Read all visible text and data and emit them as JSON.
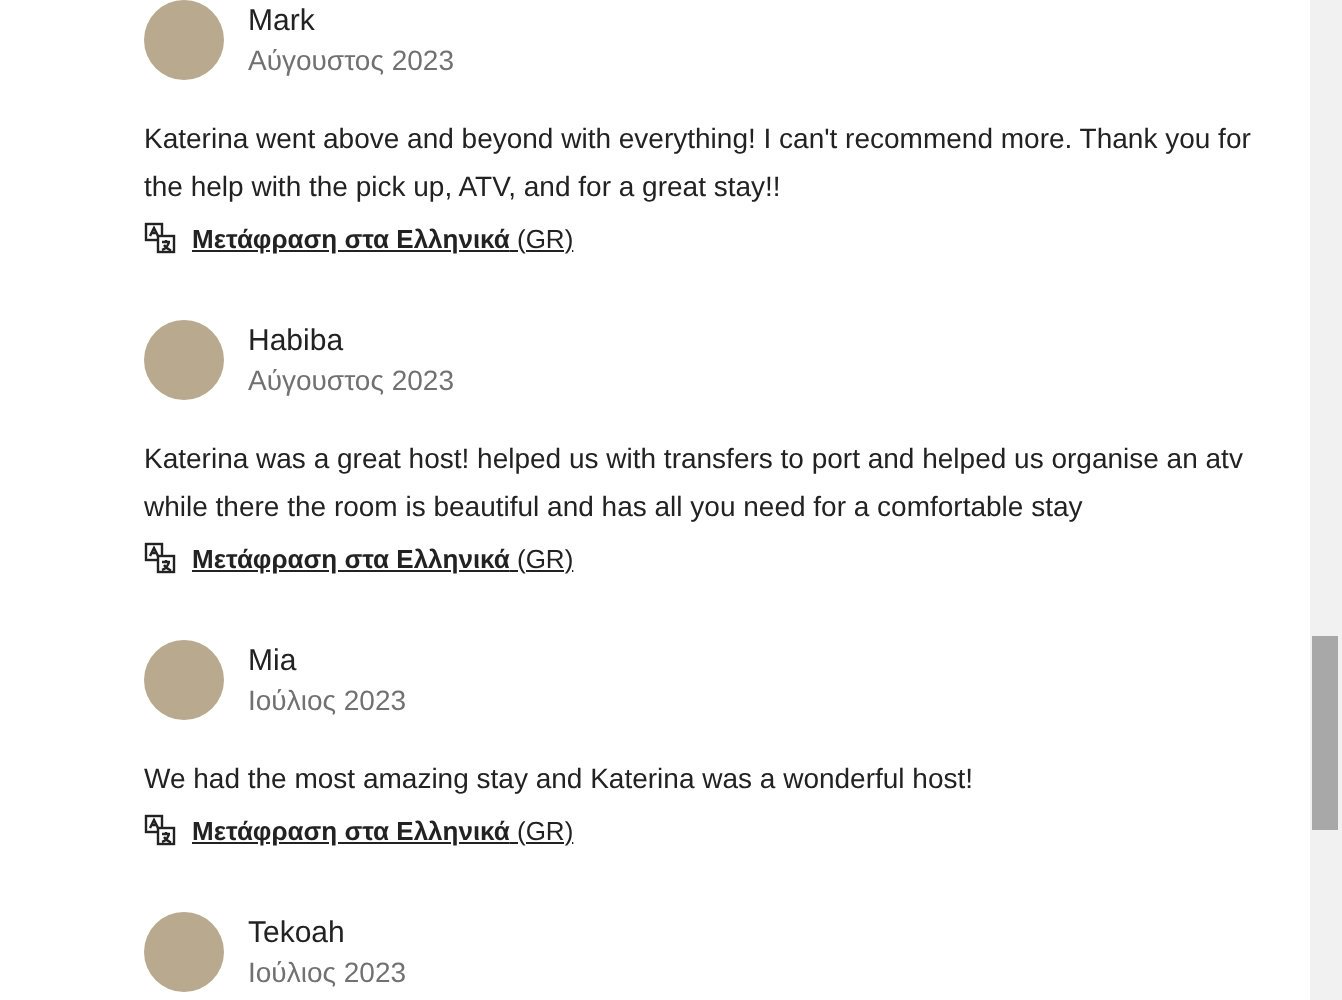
{
  "reviews": [
    {
      "name": "Mark",
      "date": "Αύγουστος 2023",
      "text": "Katerina went above and beyond with everything! I can't recommend more. Thank you for the help with the pick up, ATV, and for a great stay!!",
      "translate_link": "**Μετάφραση στα Ελληνικά** (GR)"
    },
    {
      "name": "Habiba",
      "date": "Αύγουστος 2023",
      "text": "Katerina was a great host! helped us with transfers to port and helped us organise an atv while there the room is beautiful and has all you need for a comfortable stay",
      "translate_link": "**Μετάφραση στα Ελληνικά** (GR)"
    },
    {
      "name": "Mia",
      "date": "Ιούλιος 2023",
      "text": "We had the most amazing stay and Katerina was a wonderful host!",
      "translate_link": "**Μετάφραση στα Ελληνικά** (GR)"
    },
    {
      "name": "Tekoah",
      "date": "Ιούλιος 2023"
    }
  ]
}
